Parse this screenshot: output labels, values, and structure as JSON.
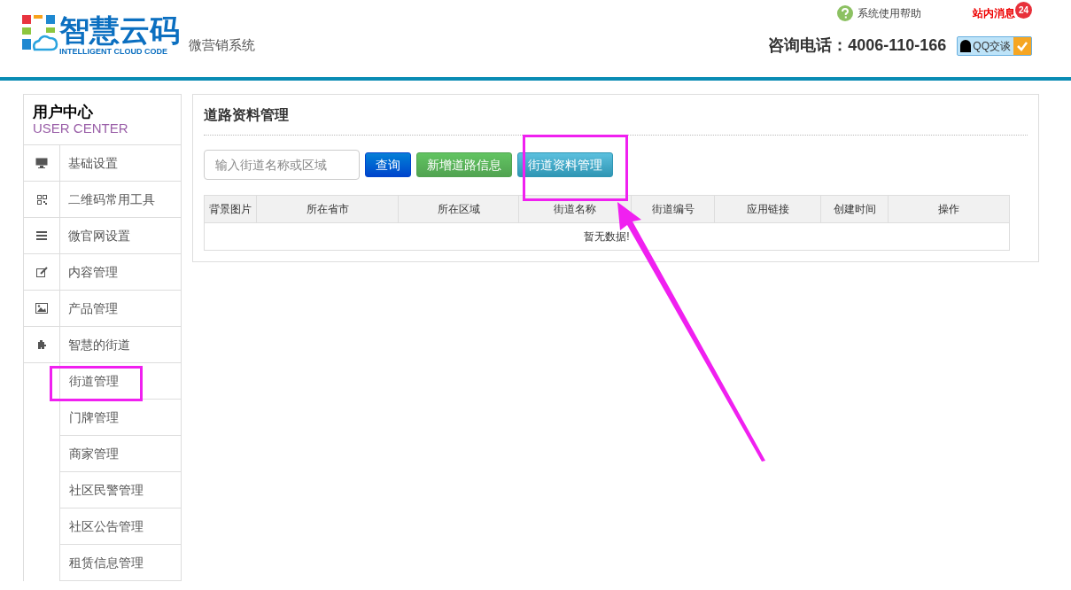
{
  "header": {
    "logo_title": "智慧云码",
    "logo_subtitle": "INTELLIGENT CLOUD CODE",
    "system_name": "微营销系统",
    "help_link": "系统使用帮助",
    "messages_link": "站内消息",
    "messages_count": "24",
    "phone": "咨询电话：4006-110-166",
    "qq_button": "QQ交谈"
  },
  "sidebar": {
    "title": "用户中心",
    "subtitle": "USER CENTER",
    "items": [
      {
        "label": "基础设置"
      },
      {
        "label": "二维码常用工具"
      },
      {
        "label": "微官网设置"
      },
      {
        "label": "内容管理"
      },
      {
        "label": "产品管理"
      },
      {
        "label": "智慧的街道",
        "children": [
          {
            "label": "街道管理"
          },
          {
            "label": "门牌管理"
          },
          {
            "label": "商家管理"
          },
          {
            "label": "社区民警管理"
          },
          {
            "label": "社区公告管理"
          },
          {
            "label": "租赁信息管理"
          }
        ]
      }
    ]
  },
  "panel": {
    "title": "道路资料管理",
    "search": {
      "placeholder": "输入街道名称或区域"
    },
    "buttons": [
      {
        "label": "查询",
        "kind": "primary"
      },
      {
        "label": "新增道路信息",
        "kind": "success"
      },
      {
        "label": "街道资料管理",
        "kind": "info"
      }
    ],
    "table": {
      "columns": [
        "背景图片",
        "所在省市",
        "所在区域",
        "街道名称",
        "街道编号",
        "应用链接",
        "创建时间",
        "操作"
      ],
      "empty_text": "暂无数据!"
    }
  }
}
